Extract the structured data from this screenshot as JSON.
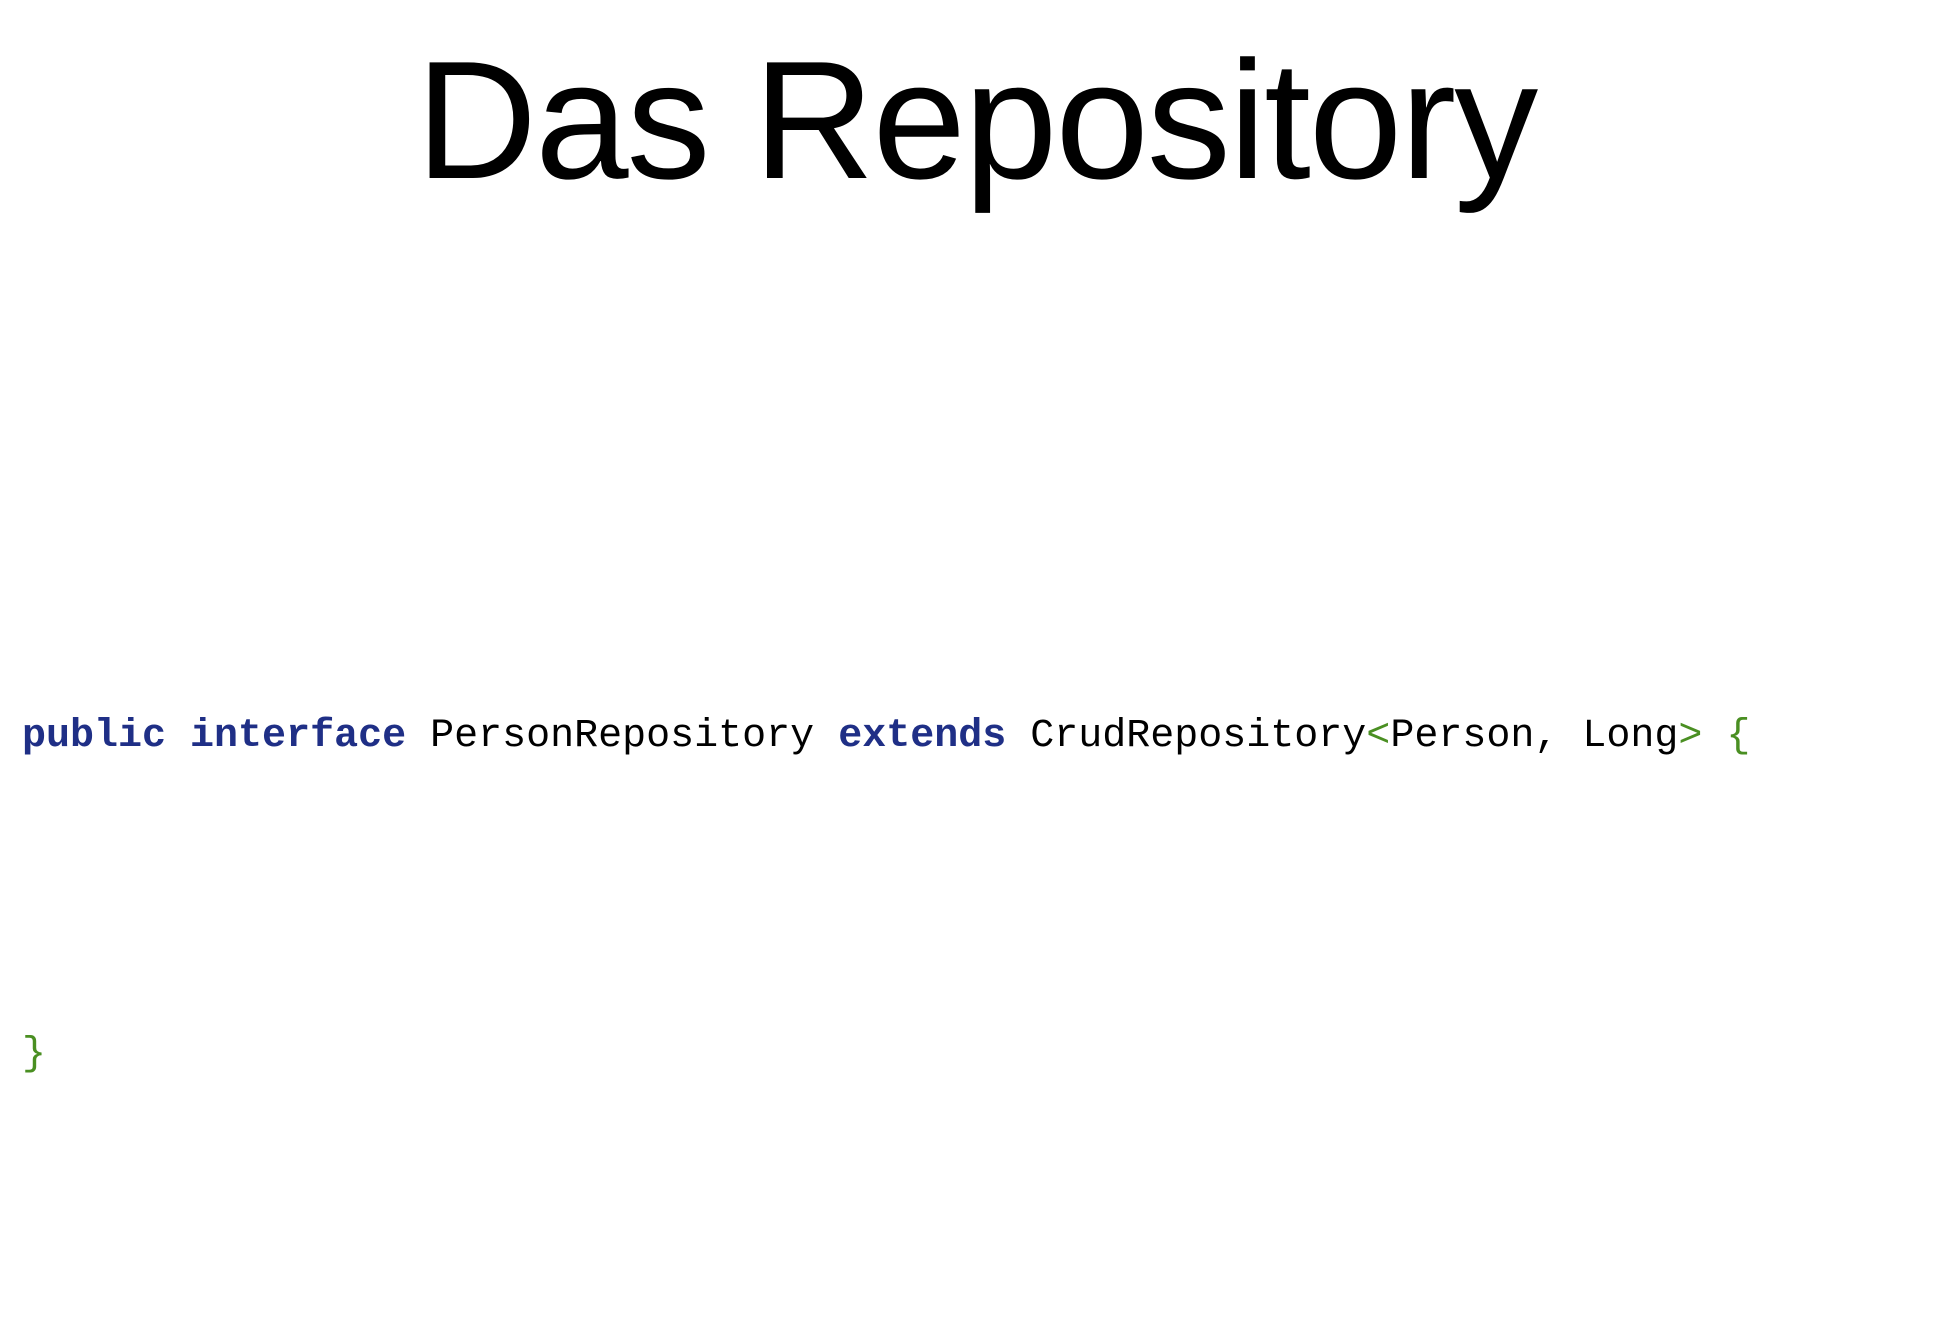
{
  "slide": {
    "title": "Das Repository"
  },
  "colors": {
    "keyword": "#1f2f86",
    "punctuation": "#4a8f22",
    "text": "#000000",
    "background": "#ffffff"
  },
  "code": {
    "line1": {
      "kw_public": "public",
      "sp1": " ",
      "kw_interface": "interface",
      "sp2": " ",
      "name": "PersonRepository",
      "sp3": " ",
      "kw_extends": "extends",
      "sp4": " ",
      "base": "CrudRepository",
      "lt": "<",
      "type1": "Person",
      "comma": ", ",
      "type2": "Long",
      "gt": ">",
      "sp5": " ",
      "open_brace": "{"
    },
    "line2": {
      "close_brace": "}"
    }
  }
}
